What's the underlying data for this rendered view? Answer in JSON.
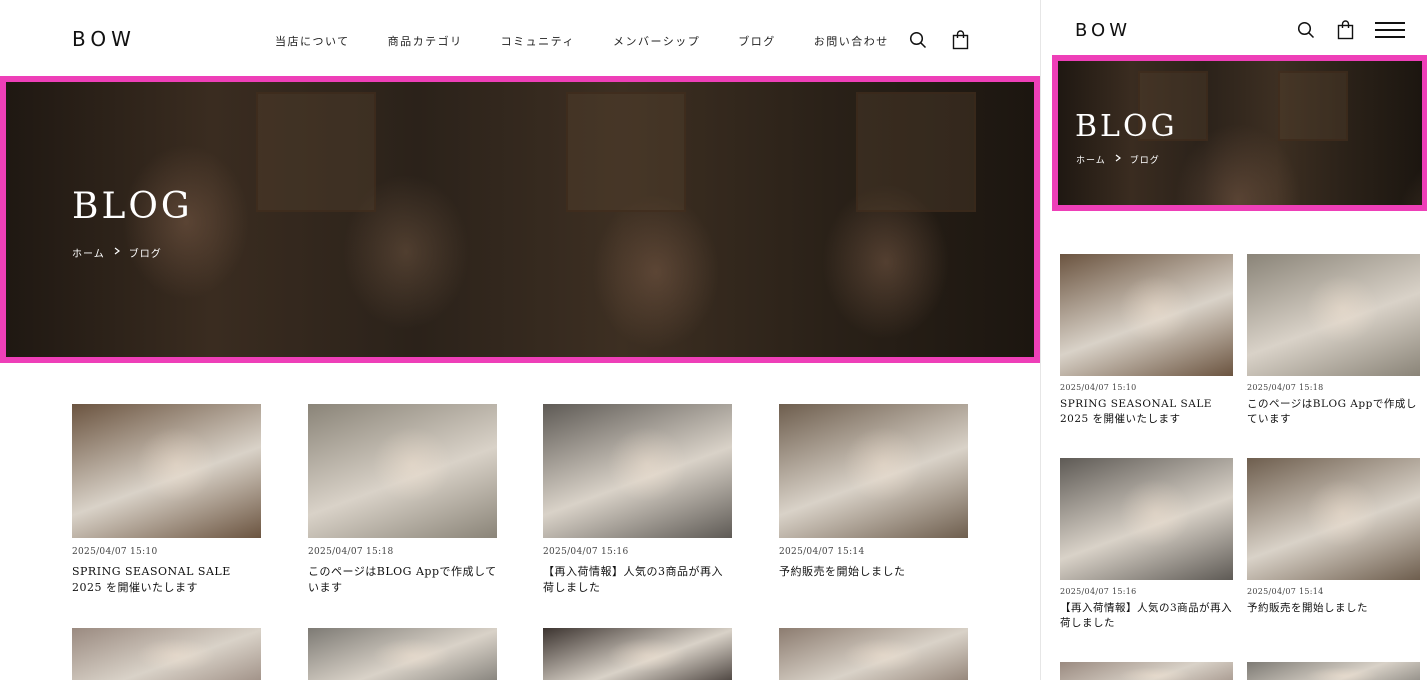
{
  "brand": {
    "logo": "BOW"
  },
  "nav": {
    "items": [
      {
        "label": "当店について"
      },
      {
        "label": "商品カテゴリ"
      },
      {
        "label": "コミュニティ"
      },
      {
        "label": "メンバーシップ"
      },
      {
        "label": "ブログ"
      },
      {
        "label": "お問い合わせ"
      }
    ]
  },
  "icons": {
    "search": "search-icon",
    "cart": "bag-icon",
    "menu": "hamburger-menu-icon",
    "breadcrumb_separator": "chevron-right-icon"
  },
  "hero": {
    "title": "BLOG",
    "breadcrumb": [
      {
        "label": "ホーム"
      },
      {
        "label": "ブログ"
      }
    ],
    "highlight_color": "#ee3fb8"
  },
  "posts": [
    {
      "date": "2025/04/07 15:10",
      "title": "SPRING SEASONAL SALE 2025 を開催いたします",
      "title_mobile": "SPRING SEASONAL SALE 2025 を開催いたします",
      "tone": "#6b5440"
    },
    {
      "date": "2025/04/07 15:18",
      "title": "このページはBLOG Appで作成しています",
      "title_mobile": "このページはBLOG Appで作成しています",
      "tone": "#8a8478"
    },
    {
      "date": "2025/04/07 15:16",
      "title": "【再入荷情報】人気の3商品が再入荷しました",
      "title_mobile": "【再入荷情報】人気の3商品が再入荷しました",
      "tone": "#5e5a55"
    },
    {
      "date": "2025/04/07 15:14",
      "title": "予約販売を開始しました",
      "title_mobile": "予約販売を開始しました",
      "tone": "#6e5e4e"
    }
  ],
  "more_post_tones": [
    "#9a8a80",
    "#7d7a74",
    "#3c3430",
    "#8c7c70"
  ]
}
